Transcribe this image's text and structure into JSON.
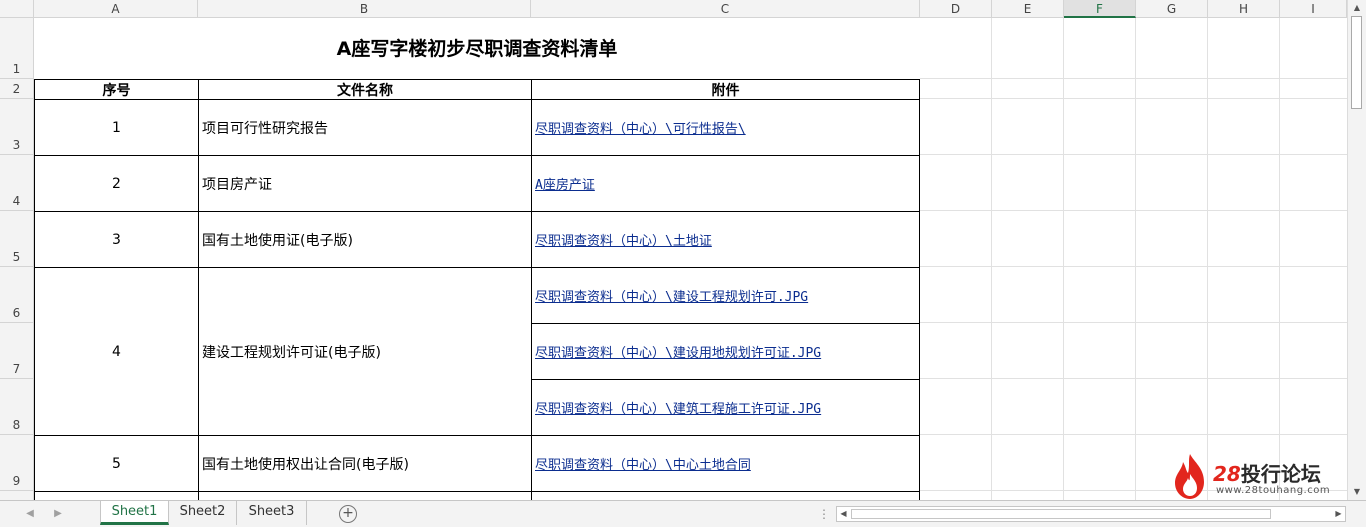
{
  "columns": [
    "A",
    "B",
    "C",
    "D",
    "E",
    "F",
    "G",
    "H",
    "I"
  ],
  "active_column": "F",
  "rows": [
    "1",
    "2",
    "3",
    "4",
    "5",
    "6",
    "7",
    "8",
    "9"
  ],
  "title": "A座写字楼初步尽职调查资料清单",
  "headers": {
    "seq": "序号",
    "name": "文件名称",
    "attachment": "附件"
  },
  "items": [
    {
      "seq": "1",
      "name": "项目可行性研究报告",
      "links": [
        "尽职调查资料（中心）\\可行性报告\\"
      ]
    },
    {
      "seq": "2",
      "name": "项目房产证",
      "links": [
        "A座房产证"
      ]
    },
    {
      "seq": "3",
      "name": "国有土地使用证(电子版)",
      "links": [
        "尽职调查资料（中心）\\土地证"
      ]
    },
    {
      "seq": "4",
      "name": "建设工程规划许可证(电子版)",
      "links": [
        "尽职调查资料（中心）\\建设工程规划许可.JPG",
        "尽职调查资料（中心）\\建设用地规划许可证.JPG",
        "尽职调查资料（中心）\\建筑工程施工许可证.JPG"
      ]
    },
    {
      "seq": "5",
      "name": "国有土地使用权出让合同(电子版)",
      "links": [
        "尽职调查资料（中心）\\中心土地合同"
      ]
    }
  ],
  "sheets": [
    "Sheet1",
    "Sheet2",
    "Sheet3"
  ],
  "active_sheet": "Sheet1",
  "add_sheet_label": "+",
  "tab_separator": "⋮",
  "logo": {
    "number": "28",
    "text": "投行论坛",
    "url": "www.28touhang.com"
  },
  "colors": {
    "accent": "#217346",
    "link": "#0b2d8f",
    "logo_red": "#e2261d"
  }
}
